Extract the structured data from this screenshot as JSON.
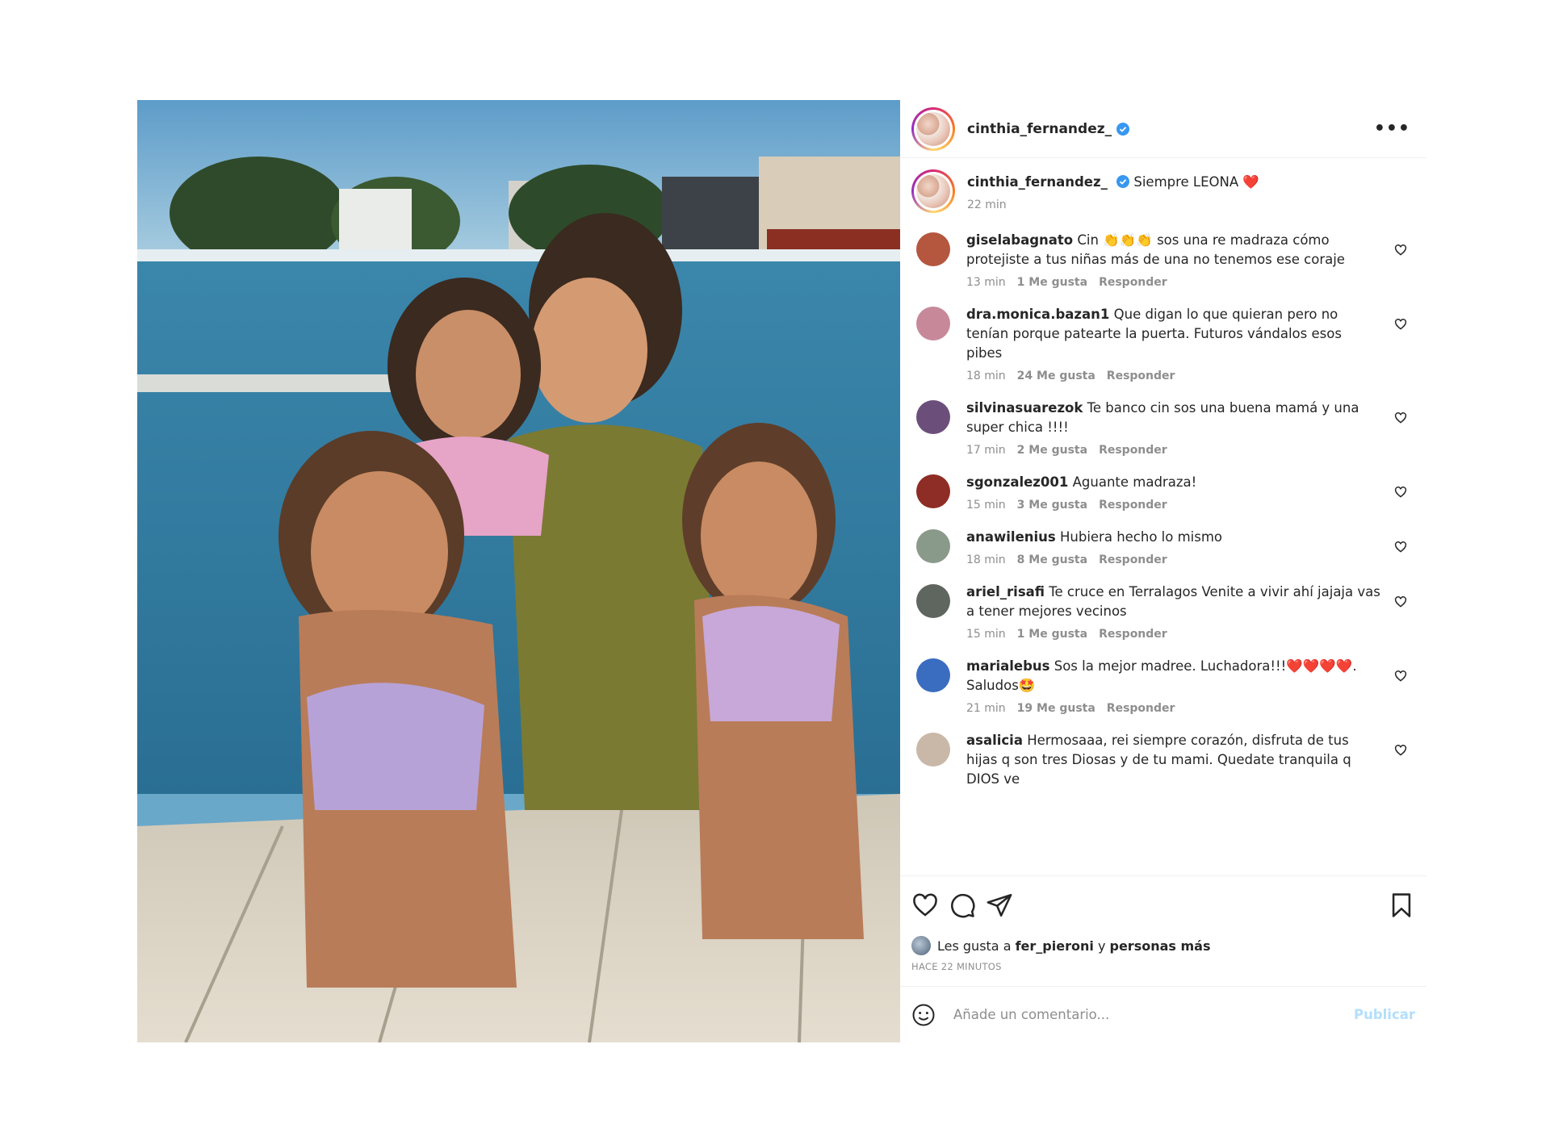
{
  "post": {
    "username": "cinthia_fernandez_",
    "more_label": "•••",
    "caption": {
      "username": "cinthia_fernandez_",
      "text": "Siempre LEONA ❤️",
      "time": "22 min"
    },
    "comments": [
      {
        "username": "giselabagnato",
        "text": "Cin 👏👏👏 sos una re madraza cómo protejiste a tus niñas más de una no tenemos ese coraje",
        "time": "13 min",
        "likes": "1 Me gusta",
        "reply": "Responder",
        "avatar_color": "#b5563f"
      },
      {
        "username": "dra.monica.bazan1",
        "text": "Que digan lo que quieran pero no tenían porque patearte la puerta. Futuros vándalos esos pibes",
        "time": "18 min",
        "likes": "24 Me gusta",
        "reply": "Responder",
        "avatar_color": "#c7899a"
      },
      {
        "username": "silvinasuarezok",
        "text": "Te banco cin sos una buena mamá y una super chica !!!!",
        "time": "17 min",
        "likes": "2 Me gusta",
        "reply": "Responder",
        "avatar_color": "#6b4f7a"
      },
      {
        "username": "sgonzalez001",
        "text": "Aguante madraza!",
        "time": "15 min",
        "likes": "3 Me gusta",
        "reply": "Responder",
        "avatar_color": "#8e2d25"
      },
      {
        "username": "anawilenius",
        "text": "Hubiera hecho lo mismo",
        "time": "18 min",
        "likes": "8 Me gusta",
        "reply": "Responder",
        "avatar_color": "#8a9a8a"
      },
      {
        "username": "ariel_risafi",
        "text": "Te cruce en Terralagos Venite a vivir ahí jajaja vas a tener mejores vecinos",
        "time": "15 min",
        "likes": "1 Me gusta",
        "reply": "Responder",
        "avatar_color": "#5f6660"
      },
      {
        "username": "marialebus",
        "text": "Sos la mejor madree. Luchadora!!!❤️❤️❤️❤️. Saludos🤩",
        "time": "21 min",
        "likes": "19 Me gusta",
        "reply": "Responder",
        "avatar_color": "#3a6dc0"
      },
      {
        "username": "asalicia",
        "text": "Hermosaaa, rei siempre corazón, disfruta de tus hijas q son tres Diosas y de tu mami. Quedate tranquila q DIOS ve",
        "time": "",
        "likes": "",
        "reply": "",
        "avatar_color": "#c9b8a8"
      }
    ],
    "likes_prefix": "Les gusta a",
    "likes_user": "fer_pieroni",
    "likes_middle": "y",
    "likes_suffix": "personas más",
    "posted_time": "HACE 22 MINUTOS",
    "comment_placeholder": "Añade un comentario...",
    "publish_label": "Publicar",
    "icons": [
      "heart-icon",
      "comment-icon",
      "share-icon",
      "bookmark-icon",
      "emoji-icon",
      "verified-icon",
      "more-icon"
    ]
  }
}
